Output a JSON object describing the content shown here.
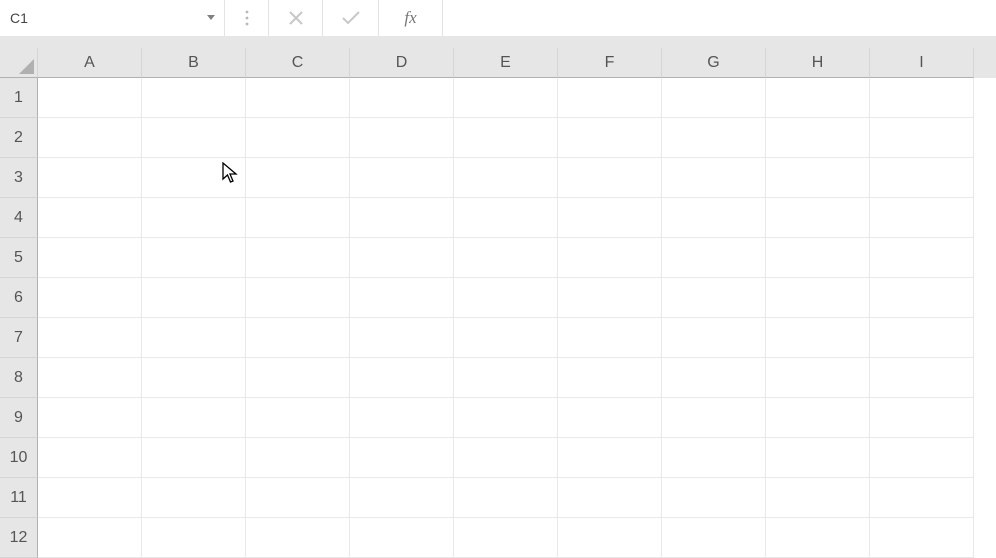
{
  "formula_bar": {
    "name_box_value": "C1",
    "formula_value": "",
    "fx_label": "fx"
  },
  "columns": [
    "A",
    "B",
    "C",
    "D",
    "E",
    "F",
    "G",
    "H",
    "I"
  ],
  "rows": [
    "1",
    "2",
    "3",
    "4",
    "5",
    "6",
    "7",
    "8",
    "9",
    "10",
    "11",
    "12"
  ],
  "cells": {}
}
